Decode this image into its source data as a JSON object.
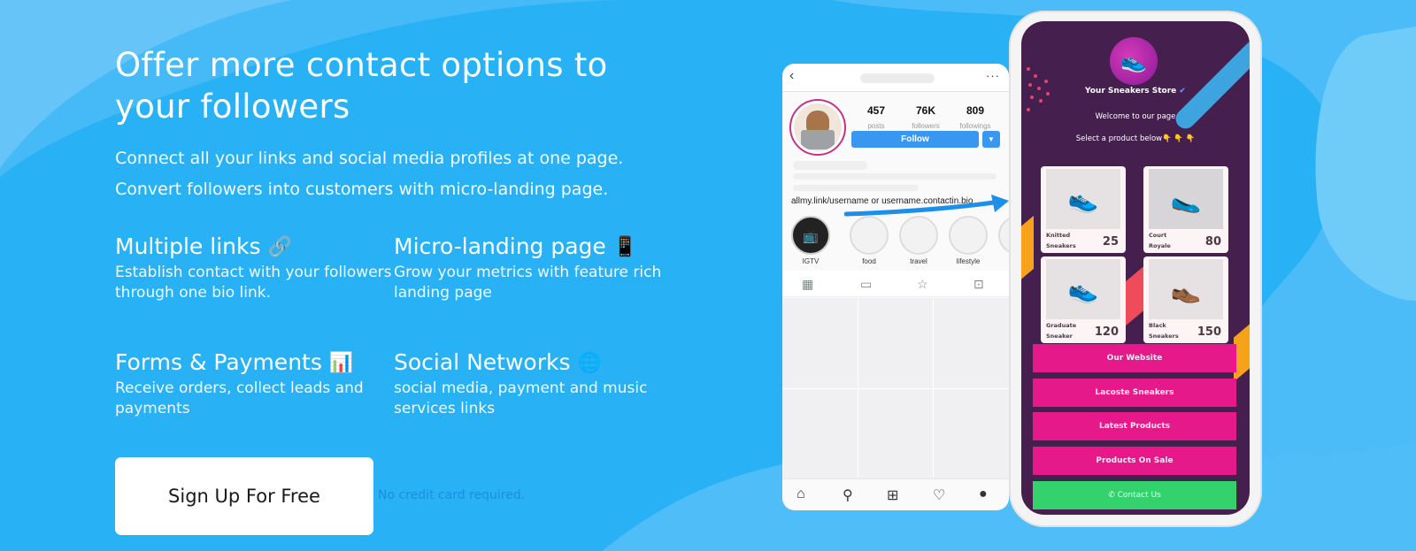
{
  "hero": {
    "title": "Offer more contact options to your followers",
    "subtitle_1": "Connect all your links and social media profiles at one page.",
    "subtitle_2": "Convert followers into customers with micro-landing page."
  },
  "features": [
    {
      "title": "Multiple links",
      "icon": "paperclip-icon",
      "emoji": "🔗",
      "desc": "Establish contact with your followers through one bio link."
    },
    {
      "title": "Micro-landing page",
      "icon": "mobile-phone-icon",
      "emoji": "📱",
      "desc": "Grow your metrics with feature rich landing page"
    },
    {
      "title": "Forms & Payments",
      "icon": "bar-chart-icon",
      "emoji": "📊",
      "desc": "Receive orders, collect leads and payments"
    },
    {
      "title": "Social Networks",
      "icon": "globe-icon",
      "emoji": "🌐",
      "desc": "social media, payment and music services links"
    }
  ],
  "cta": {
    "signup_label": "Sign Up For Free",
    "note": "No credit card required."
  },
  "instagram_mockup": {
    "stats": [
      {
        "value": "457",
        "label": "posts"
      },
      {
        "value": "76K",
        "label": "followers"
      },
      {
        "value": "809",
        "label": "followings"
      }
    ],
    "follow_label": "Follow",
    "bio_link": "allmy.link/username or username.contactin.bio",
    "highlights": [
      "IGTV",
      "food",
      "travel",
      "lifestyle"
    ]
  },
  "store_mockup": {
    "store_name": "Your Sneakers Store",
    "verified": true,
    "welcome": "Welcome to our page",
    "select_prompt": "Select a product below👇 👇 👇",
    "products": [
      {
        "name": "Knitted Sneakers",
        "price": "25",
        "color": "black"
      },
      {
        "name": "Court Royale",
        "price": "80",
        "color": "white"
      },
      {
        "name": "Graduate Sneaker",
        "price": "120",
        "color": "white"
      },
      {
        "name": "Black Sneakers",
        "price": "150",
        "color": "black"
      }
    ],
    "buttons": [
      "Our Website",
      "Lacoste Sneakers",
      "Latest Products",
      "Products On Sale"
    ],
    "contact_label": "Contact Us"
  },
  "colors": {
    "background": "#29b1f6",
    "store_bg": "#45204f",
    "store_button": "#e6198b",
    "contact_button": "#33d26c",
    "follow_button": "#3897f0"
  }
}
